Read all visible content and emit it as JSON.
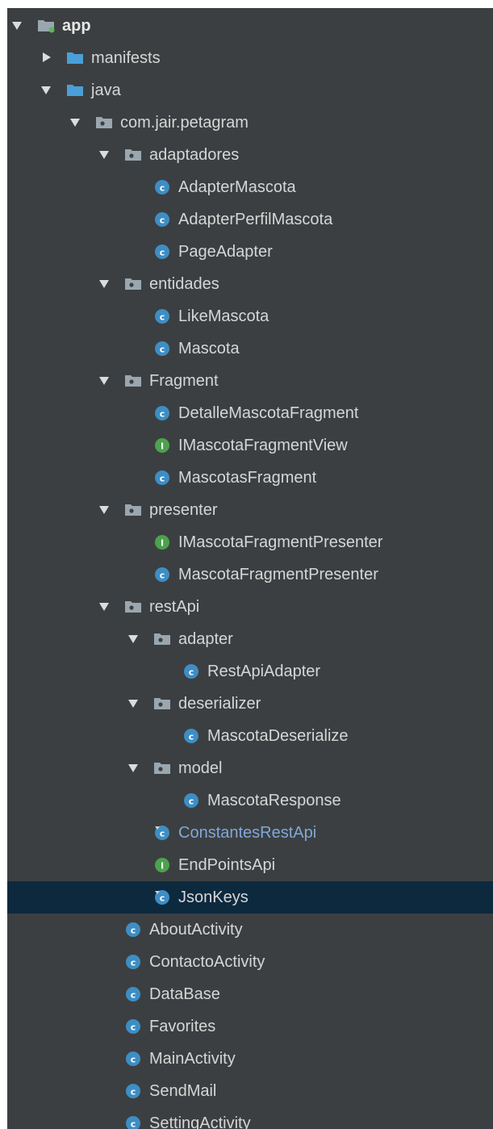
{
  "colors": {
    "panel_bg": "#3c3f41",
    "selected_bg": "#0d293e",
    "text": "#d6d6d6",
    "link_text": "#7fa8d8",
    "class_icon": "#3d8ec4",
    "interface_icon": "#4ca24d",
    "folder_icon": "#9aa7b0",
    "source_folder_icon": "#4a9fd8"
  },
  "tree": {
    "nodes": [
      {
        "label": "app",
        "level": 0,
        "arrow": "expanded",
        "icon": "module-folder-icon",
        "style": "module"
      },
      {
        "label": "manifests",
        "level": 1,
        "arrow": "collapsed",
        "icon": "source-folder-icon"
      },
      {
        "label": "java",
        "level": 1,
        "arrow": "expanded",
        "icon": "source-folder-icon"
      },
      {
        "label": "com.jair.petagram",
        "level": 2,
        "arrow": "expanded",
        "icon": "package-icon"
      },
      {
        "label": "adaptadores",
        "level": 3,
        "arrow": "expanded",
        "icon": "package-icon"
      },
      {
        "label": "AdapterMascota",
        "level": 4,
        "arrow": "none",
        "icon": "class-icon"
      },
      {
        "label": "AdapterPerfilMascota",
        "level": 4,
        "arrow": "none",
        "icon": "class-icon"
      },
      {
        "label": "PageAdapter",
        "level": 4,
        "arrow": "none",
        "icon": "class-icon"
      },
      {
        "label": "entidades",
        "level": 3,
        "arrow": "expanded",
        "icon": "package-icon"
      },
      {
        "label": "LikeMascota",
        "level": 4,
        "arrow": "none",
        "icon": "class-icon"
      },
      {
        "label": "Mascota",
        "level": 4,
        "arrow": "none",
        "icon": "class-icon"
      },
      {
        "label": "Fragment",
        "level": 3,
        "arrow": "expanded",
        "icon": "package-icon"
      },
      {
        "label": "DetalleMascotaFragment",
        "level": 4,
        "arrow": "none",
        "icon": "class-icon"
      },
      {
        "label": "IMascotaFragmentView",
        "level": 4,
        "arrow": "none",
        "icon": "interface-icon"
      },
      {
        "label": "MascotasFragment",
        "level": 4,
        "arrow": "none",
        "icon": "class-icon"
      },
      {
        "label": "presenter",
        "level": 3,
        "arrow": "expanded",
        "icon": "package-icon"
      },
      {
        "label": "IMascotaFragmentPresenter",
        "level": 4,
        "arrow": "none",
        "icon": "interface-icon"
      },
      {
        "label": "MascotaFragmentPresenter",
        "level": 4,
        "arrow": "none",
        "icon": "class-icon"
      },
      {
        "label": "restApi",
        "level": 3,
        "arrow": "expanded",
        "icon": "package-icon"
      },
      {
        "label": "adapter",
        "level": 4,
        "arrow": "expanded",
        "icon": "package-icon"
      },
      {
        "label": "RestApiAdapter",
        "level": 5,
        "arrow": "none",
        "icon": "class-icon"
      },
      {
        "label": "deserializer",
        "level": 4,
        "arrow": "expanded",
        "icon": "package-icon"
      },
      {
        "label": "MascotaDeserialize",
        "level": 5,
        "arrow": "none",
        "icon": "class-icon"
      },
      {
        "label": "model",
        "level": 4,
        "arrow": "expanded",
        "icon": "package-icon"
      },
      {
        "label": "MascotaResponse",
        "level": 5,
        "arrow": "none",
        "icon": "class-icon"
      },
      {
        "label": "ConstantesRestApi",
        "level": 4,
        "arrow": "none",
        "icon": "static-class-icon",
        "style": "link"
      },
      {
        "label": "EndPointsApi",
        "level": 4,
        "arrow": "none",
        "icon": "interface-icon"
      },
      {
        "label": "JsonKeys",
        "level": 4,
        "arrow": "none",
        "icon": "static-class-icon",
        "selected": true
      },
      {
        "label": "AboutActivity",
        "level": 3,
        "arrow": "none",
        "icon": "class-icon"
      },
      {
        "label": "ContactoActivity",
        "level": 3,
        "arrow": "none",
        "icon": "class-icon"
      },
      {
        "label": "DataBase",
        "level": 3,
        "arrow": "none",
        "icon": "class-icon"
      },
      {
        "label": "Favorites",
        "level": 3,
        "arrow": "none",
        "icon": "class-icon"
      },
      {
        "label": "MainActivity",
        "level": 3,
        "arrow": "none",
        "icon": "class-icon"
      },
      {
        "label": "SendMail",
        "level": 3,
        "arrow": "none",
        "icon": "class-icon"
      },
      {
        "label": "SettingActivity",
        "level": 3,
        "arrow": "none",
        "icon": "class-icon"
      }
    ]
  }
}
